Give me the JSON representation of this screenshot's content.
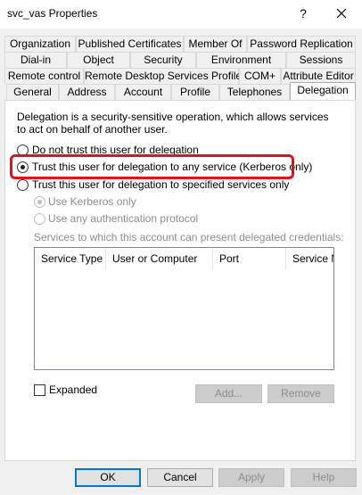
{
  "window": {
    "title": "svc_vas Properties",
    "help_glyph": "?"
  },
  "tabs": {
    "row1": [
      "Organization",
      "Published Certificates",
      "Member Of",
      "Password Replication"
    ],
    "row2": [
      "Dial-in",
      "Object",
      "Security",
      "Environment",
      "Sessions"
    ],
    "row3": [
      "Remote control",
      "Remote Desktop Services Profile",
      "COM+",
      "Attribute Editor"
    ],
    "row4": [
      "General",
      "Address",
      "Account",
      "Profile",
      "Telephones",
      "Delegation"
    ],
    "active": "Delegation"
  },
  "delegation": {
    "description": "Delegation is a security-sensitive operation, which allows services to act on behalf of another user.",
    "options": [
      {
        "label": "Do not trust this user for delegation",
        "checked": false
      },
      {
        "label": "Trust this user for delegation to any service (Kerberos only)",
        "checked": true
      },
      {
        "label": "Trust this user for delegation to specified services only",
        "checked": false
      }
    ],
    "sub_options": [
      {
        "label": "Use Kerberos only",
        "checked": true
      },
      {
        "label": "Use any authentication protocol",
        "checked": false
      }
    ],
    "services_label": "Services to which this account can present delegated credentials:",
    "columns": [
      "Service Type",
      "User or Computer",
      "Port",
      "Service N"
    ],
    "expanded_label": "Expanded",
    "expanded_checked": false,
    "add_label": "Add...",
    "remove_label": "Remove"
  },
  "footer": {
    "ok": "OK",
    "cancel": "Cancel",
    "apply": "Apply",
    "help": "Help"
  },
  "colors": {
    "highlight": "#e0121b",
    "accent": "#0078d7"
  }
}
